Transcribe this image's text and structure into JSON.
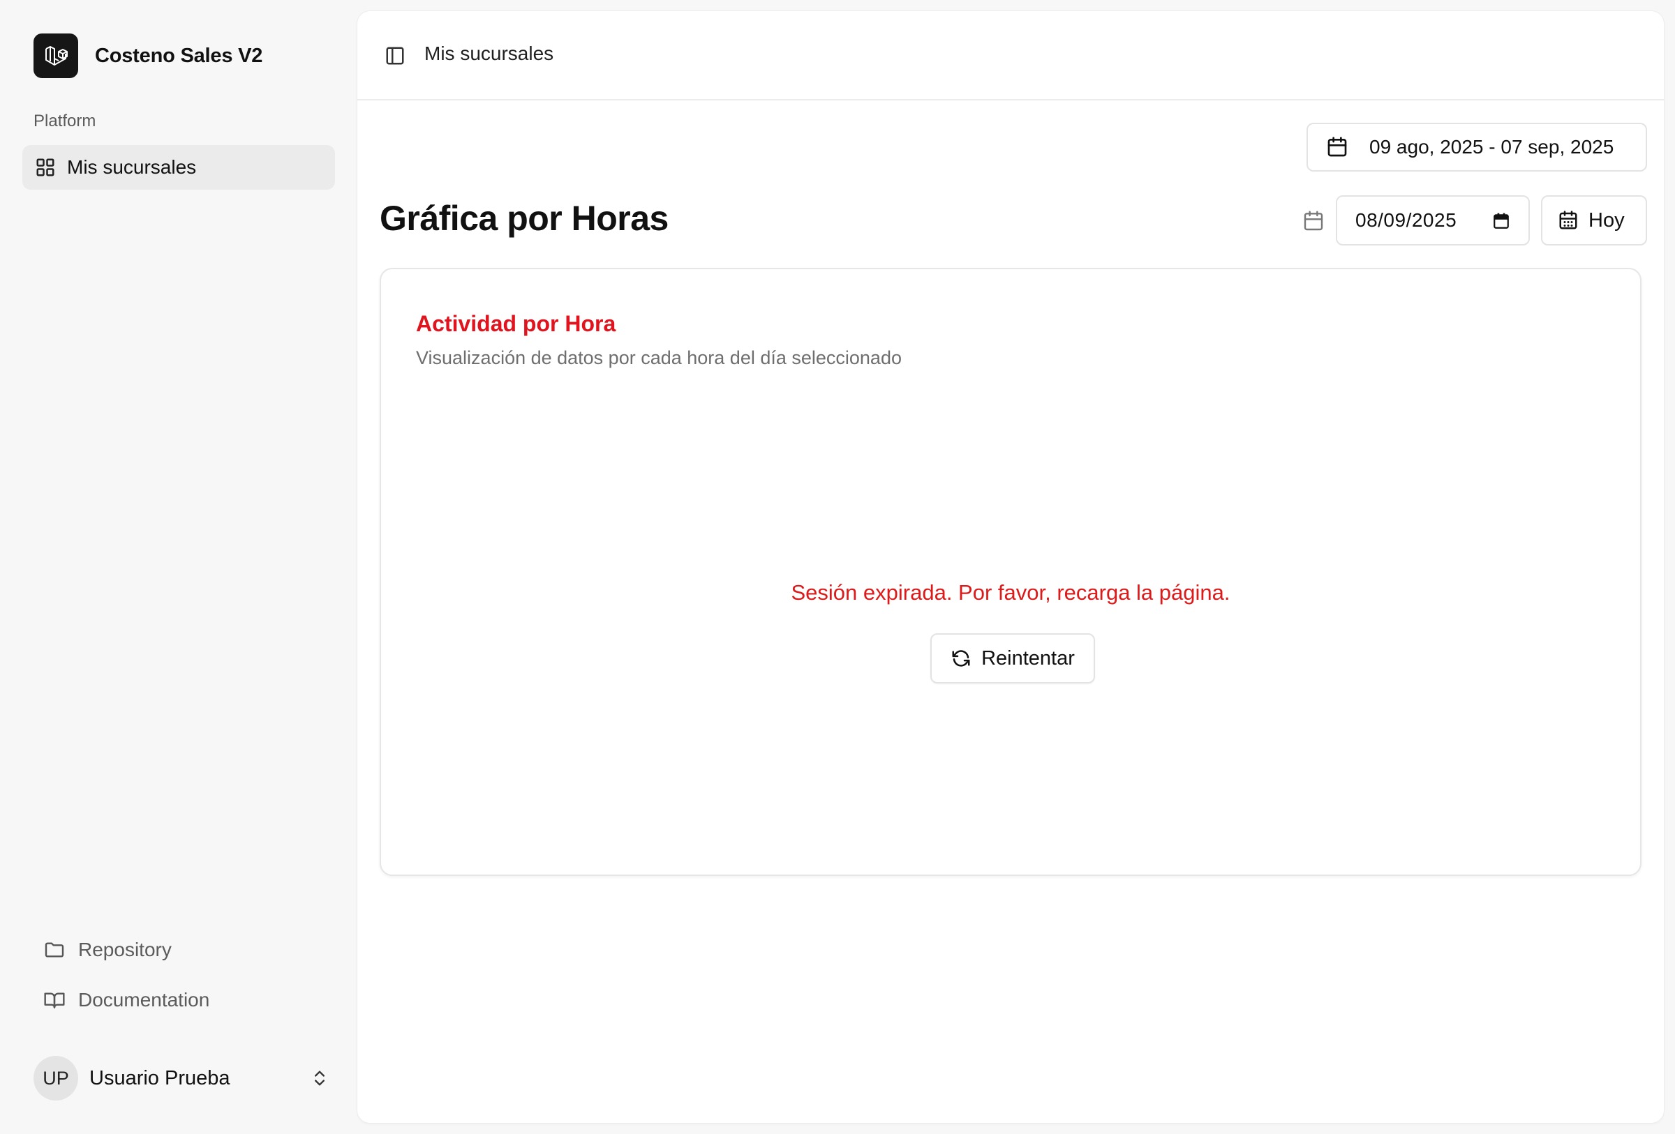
{
  "app": {
    "name": "Costeno Sales V2"
  },
  "sidebar": {
    "group_label": "Platform",
    "nav_items": [
      {
        "label": "Mis sucursales",
        "icon": "grid-icon",
        "active": true
      }
    ],
    "footer_links": [
      {
        "label": "Repository",
        "icon": "folder-icon"
      },
      {
        "label": "Documentation",
        "icon": "book-icon"
      }
    ],
    "user": {
      "initials": "UP",
      "name": "Usuario Prueba"
    }
  },
  "header": {
    "breadcrumb": "Mis sucursales"
  },
  "filters": {
    "date_range": "09 ago, 2025 - 07 sep, 2025",
    "selected_date": "08/09/2025",
    "today_label": "Hoy"
  },
  "page": {
    "title": "Gráfica por Horas"
  },
  "card": {
    "title": "Actividad por Hora",
    "subtitle": "Visualización de datos por cada hora del día seleccionado",
    "error_message": "Sesión expirada. Por favor, recarga la página.",
    "retry_label": "Reintentar"
  },
  "colors": {
    "accent_error": "#dc1a1a",
    "logo_bg": "#161616"
  }
}
